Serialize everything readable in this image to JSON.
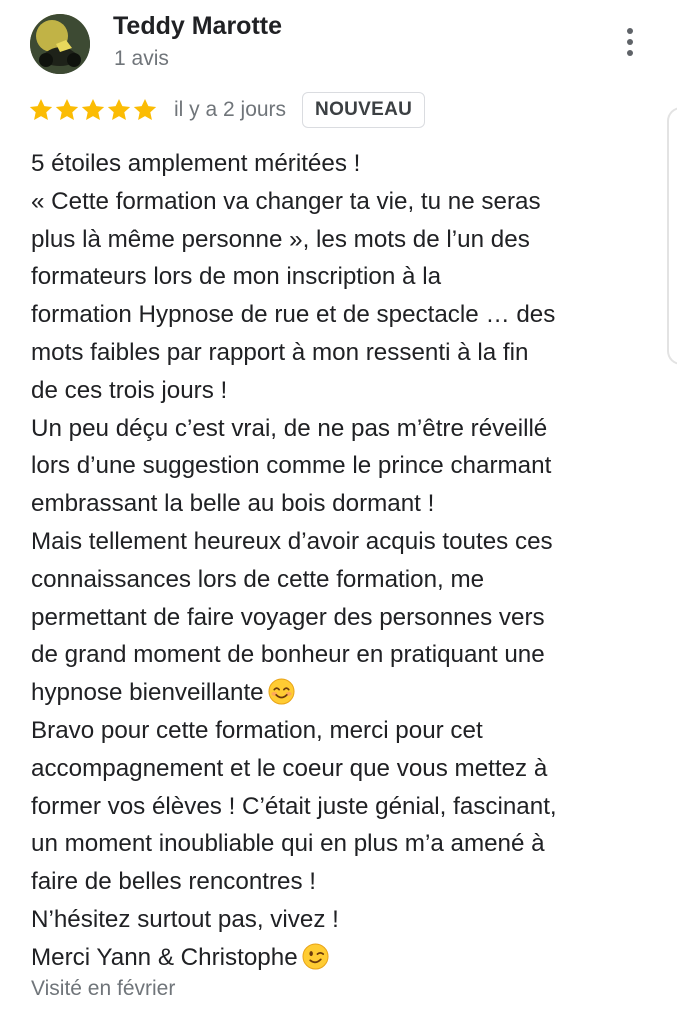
{
  "reviewer": {
    "name": "Teddy Marotte",
    "review_count": "1 avis"
  },
  "rating": {
    "stars": 5,
    "max_stars": 5,
    "star_color": "#fbbc04",
    "date": "il y a 2 jours",
    "badge": "NOUVEAU"
  },
  "review": {
    "lines": [
      "5 étoiles amplement méritées !",
      "« Cette formation va changer ta vie, tu ne seras",
      "plus là même personne », les mots de l’un des",
      "formateurs lors de mon inscription à la",
      "formation Hypnose de rue et de spectacle … des",
      "mots faibles par rapport à mon ressenti à la fin",
      "de ces trois jours !",
      "Un peu déçu c’est vrai, de ne pas m’être réveillé",
      "lors d’une suggestion comme le prince charmant",
      "embrassant la belle au bois dormant !",
      "Mais tellement heureux d’avoir acquis toutes ces",
      "connaissances lors de cette formation, me",
      "permettant de faire voyager des personnes vers",
      "de grand moment de bonheur en pratiquant une",
      "hypnose bienveillante",
      "Bravo pour cette formation, merci pour cet",
      "accompagnement et le coeur que vous mettez à",
      "former vos élèves ! C’était juste génial, fascinant,",
      "un moment inoubliable qui en plus m’a amené à",
      "faire de belles rencontres !",
      "N’hésitez surtout pas, vivez !",
      "Merci Yann & Christophe"
    ],
    "emoji_after_line_15": "smiling-face-with-smiling-eyes-emoji",
    "emoji_after_line_22": "winking-face-emoji"
  },
  "visited": "Visité en février",
  "icons": {
    "more": "more-vert-icon",
    "star": "star-icon",
    "avatar": "reviewer-avatar"
  }
}
